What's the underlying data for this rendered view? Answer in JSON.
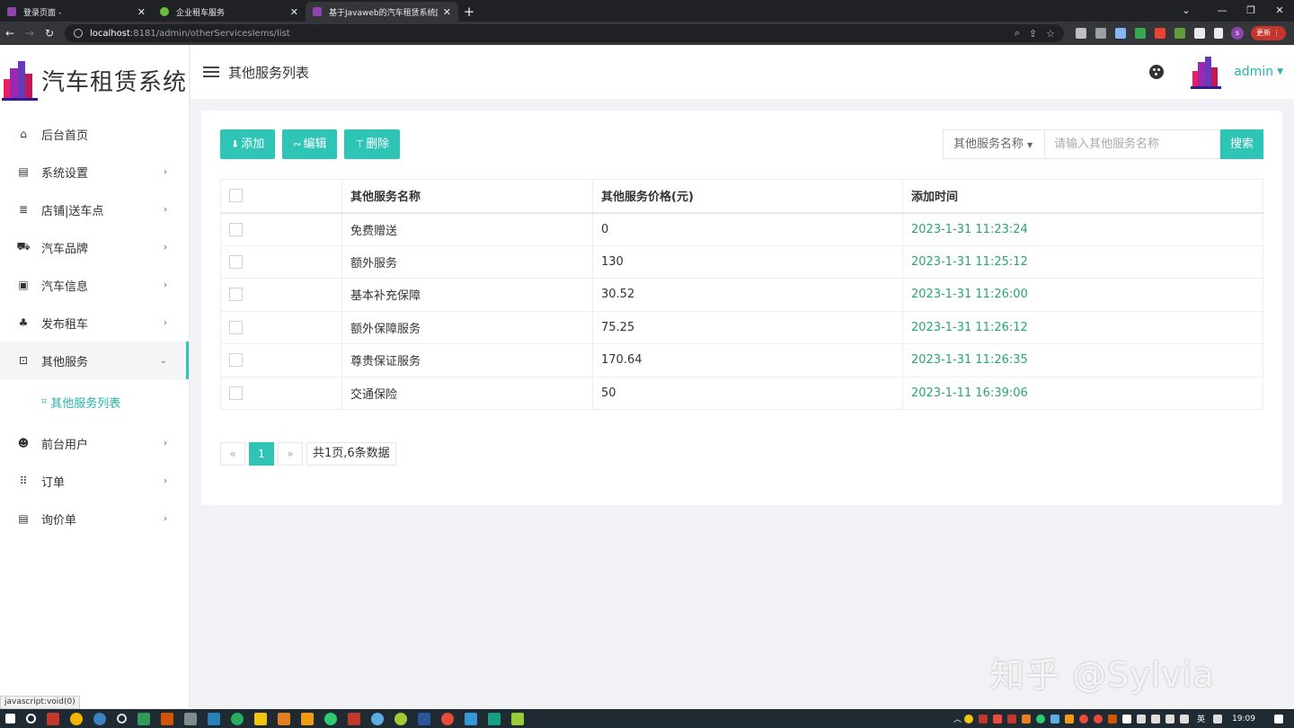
{
  "browser": {
    "tabs": [
      {
        "title": "登录页面 -",
        "active": false,
        "color": "#8e44ad"
      },
      {
        "title": "企业租车服务",
        "active": false,
        "color": "#6cbf3c"
      },
      {
        "title": "基于Javaweb的汽车租赁系统[…",
        "active": true,
        "color": "#8e44ad"
      }
    ],
    "url_host": "localhost",
    "url_rest": ":8181/admin/otherServicesIems/list",
    "profile_initial": "s",
    "update_label": "更新"
  },
  "brand": {
    "title": "汽车租赁系统"
  },
  "menu": [
    {
      "label": "后台首页",
      "icon": "home-icon",
      "glyph": "⌂",
      "arrow": ""
    },
    {
      "label": "系统设置",
      "icon": "settings-icon",
      "glyph": "▤",
      "arrow": "›"
    },
    {
      "label": "店铺|送车点",
      "icon": "store-icon",
      "glyph": "≣",
      "arrow": "›"
    },
    {
      "label": "汽车品牌",
      "icon": "car-brand-icon",
      "glyph": "⛟",
      "arrow": "›"
    },
    {
      "label": "汽车信息",
      "icon": "car-info-icon",
      "glyph": "▣",
      "arrow": "›"
    },
    {
      "label": "发布租车",
      "icon": "sitemap-icon",
      "glyph": "♣",
      "arrow": "›"
    },
    {
      "label": "其他服务",
      "icon": "service-icon",
      "glyph": "⊡",
      "arrow": "⌄"
    },
    {
      "label": "前台用户",
      "icon": "users-icon",
      "glyph": "☻",
      "arrow": "›"
    },
    {
      "label": "订单",
      "icon": "order-icon",
      "glyph": "⠿",
      "arrow": "›"
    },
    {
      "label": "询价单",
      "icon": "inquiry-icon",
      "glyph": "▤",
      "arrow": "›"
    }
  ],
  "submenu": {
    "label": "其他服务列表",
    "glyph": "⌗"
  },
  "header": {
    "page_title": "其他服务列表",
    "user": "admin"
  },
  "toolbar": {
    "add": "添加",
    "edit": "编辑",
    "delete": "删除"
  },
  "search": {
    "field": "其他服务名称",
    "placeholder": "请输入其他服务名称",
    "button": "搜索"
  },
  "table": {
    "columns": [
      "",
      "其他服务名称",
      "其他服务价格(元)",
      "添加时间"
    ],
    "rows": [
      {
        "name": "免费赠送",
        "price": "0",
        "time": "2023-1-31 11:23:24"
      },
      {
        "name": "额外服务",
        "price": "130",
        "time": "2023-1-31 11:25:12"
      },
      {
        "name": "基本补充保障",
        "price": "30.52",
        "time": "2023-1-31 11:26:00"
      },
      {
        "name": "额外保障服务",
        "price": "75.25",
        "time": "2023-1-31 11:26:12"
      },
      {
        "name": "尊贵保证服务",
        "price": "170.64",
        "time": "2023-1-31 11:26:35"
      },
      {
        "name": "交通保险",
        "price": "50",
        "time": "2023-1-11 16:39:06"
      }
    ]
  },
  "pager": {
    "prev": "«",
    "current": "1",
    "next": "»",
    "info": "共1页,6条数据"
  },
  "status_text": "javascript:void(0)",
  "watermark": "知乎 @Sylvia",
  "taskbar": {
    "lang": "英",
    "time": "19:09"
  },
  "colors": {
    "accent": "#2ec4b6",
    "time_text": "#26a86c"
  }
}
